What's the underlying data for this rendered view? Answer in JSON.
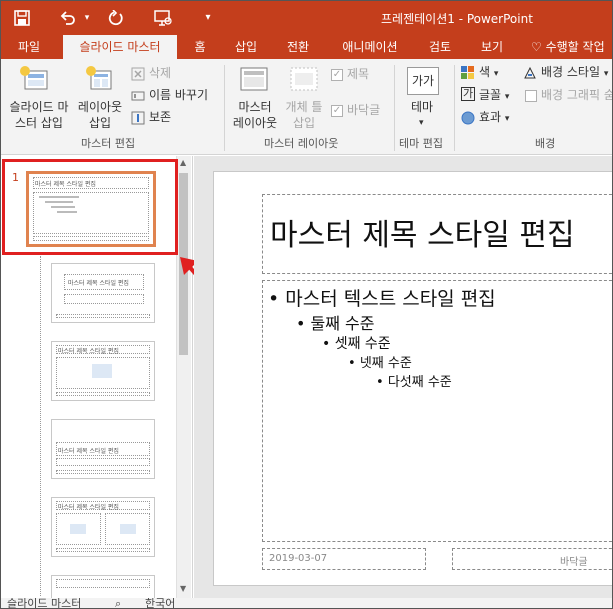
{
  "window": {
    "title": "프레젠테이션1 - PowerPoint"
  },
  "quick_access": {
    "save": "save-icon",
    "undo": "undo-icon",
    "redo": "redo-icon",
    "present": "present-icon",
    "customize": "customize-icon"
  },
  "tabs": [
    {
      "label": "파일"
    },
    {
      "label": "슬라이드 마스터"
    },
    {
      "label": "홈"
    },
    {
      "label": "삽입"
    },
    {
      "label": "전환"
    },
    {
      "label": "애니메이션"
    },
    {
      "label": "검토"
    },
    {
      "label": "보기"
    }
  ],
  "tell_me": "수행할 작업",
  "ribbon": {
    "master_edit": {
      "insert_slide_master": "슬라이드 마\n스터 삽입",
      "insert_layout": "레이아웃\n삽입",
      "delete": "삭제",
      "rename": "이름 바꾸기",
      "preserve": "보존",
      "group": "마스터 편집"
    },
    "master_layout": {
      "master_layout_btn": "마스터\n레이아웃",
      "insert_placeholder": "개체 틀\n삽입",
      "title_chk": "제목",
      "footer_chk": "바닥글",
      "group": "마스터 레이아웃"
    },
    "theme_edit": {
      "theme": "테마",
      "theme_icon_text": "가가",
      "group": "테마 편집"
    },
    "background": {
      "colors": "색",
      "fonts": "글꼴",
      "fonts_icon_text": "가",
      "effects": "효과",
      "bg_styles": "배경 스타일",
      "hide_bg": "배경 그래픽 숨",
      "group": "배경"
    }
  },
  "thumbnails": {
    "number": "1",
    "master_title": "마스터 제목 스타일 편집",
    "layout2_title": "마스터 제목 스타일 편집",
    "layout3_title": "마스터 제목 스타일 편집",
    "layout4_title": "마스터 제목 스타일 편집",
    "layout5_title": "마스터 제목 스타일 편집"
  },
  "slide": {
    "title": "마스터 제목 스타일 편집",
    "levels": [
      "마스터 텍스트 스타일 편집",
      "둘째 수준",
      "셋째 수준",
      "넷째 수준",
      "다섯째 수준"
    ],
    "date": "2019-03-07",
    "footer": "바닥글"
  },
  "status": {
    "left": "슬라이드 마스터",
    "lang": "한국어"
  },
  "colors": {
    "accent": "#c43e1c",
    "highlight": "#e02020"
  }
}
